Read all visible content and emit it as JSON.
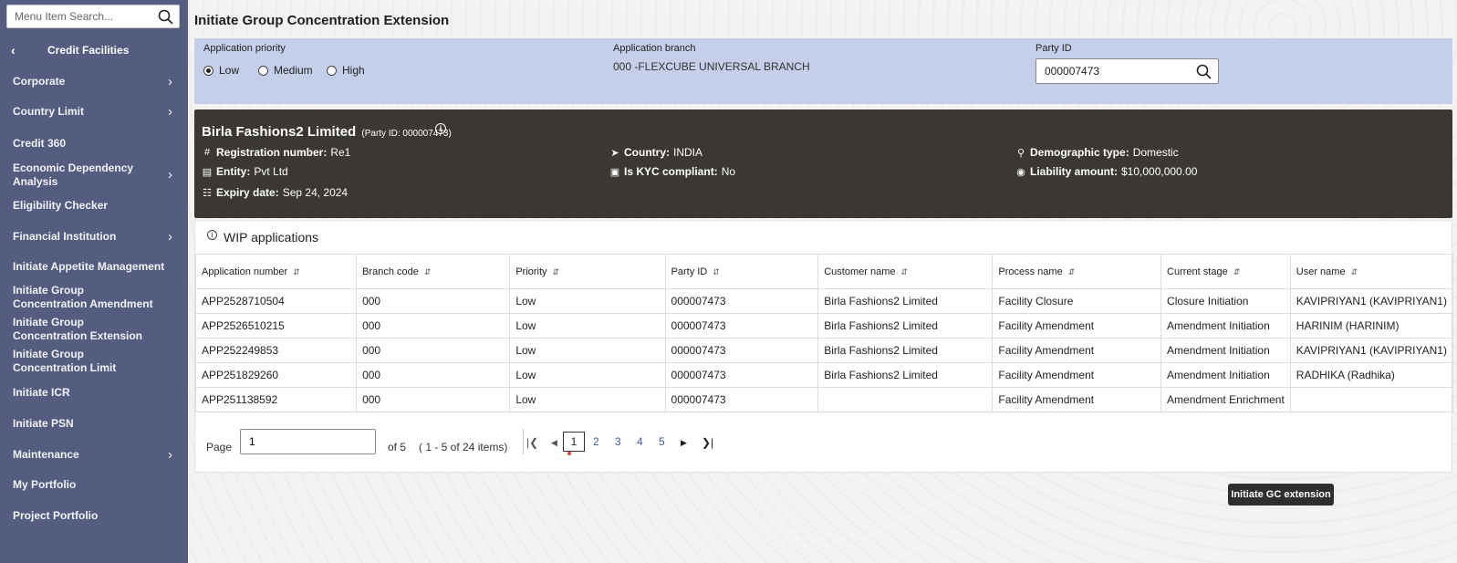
{
  "search": {
    "placeholder": "Menu Item Search..."
  },
  "sidebar": {
    "header": "Credit Facilities",
    "items": [
      {
        "label": "Corporate",
        "has_children": true
      },
      {
        "label": "Country Limit",
        "has_children": true
      },
      {
        "label": "Credit 360",
        "has_children": false
      },
      {
        "label": "Economic Dependency Analysis",
        "has_children": true
      },
      {
        "label": "Eligibility Checker",
        "has_children": false
      },
      {
        "label": "Financial Institution",
        "has_children": true
      },
      {
        "label": "Initiate Appetite Management",
        "has_children": false
      },
      {
        "label": "Initiate Group Concentration Amendment",
        "has_children": false
      },
      {
        "label": "Initiate Group Concentration Extension",
        "has_children": false
      },
      {
        "label": "Initiate Group Concentration Limit",
        "has_children": false
      },
      {
        "label": "Initiate ICR",
        "has_children": false
      },
      {
        "label": "Initiate PSN",
        "has_children": false
      },
      {
        "label": "Maintenance",
        "has_children": true
      },
      {
        "label": "My Portfolio",
        "has_children": false
      },
      {
        "label": "Project Portfolio",
        "has_children": false
      }
    ]
  },
  "page": {
    "title": "Initiate Group Concentration Extension"
  },
  "form": {
    "priority_label": "Application priority",
    "priority_options": [
      "Low",
      "Medium",
      "High"
    ],
    "priority_selected": "Low",
    "branch_label": "Application branch",
    "branch_value": "000 -FLEXCUBE UNIVERSAL BRANCH",
    "party_label": "Party ID",
    "party_value": "000007473"
  },
  "party": {
    "name": "Birla Fashions2 Limited",
    "party_id_text": "(Party ID: 000007473)",
    "registration_label": "Registration number:",
    "registration_value": "Re1",
    "country_label": "Country:",
    "country_value": "INDIA",
    "demographic_label": "Demographic type:",
    "demographic_value": "Domestic",
    "entity_label": "Entity:",
    "entity_value": "Pvt Ltd",
    "kyc_label": "Is KYC compliant:",
    "kyc_value": "No",
    "liability_label": "Liability amount:",
    "liability_value": "$10,000,000.00",
    "expiry_label": "Expiry date:",
    "expiry_value": "Sep 24, 2024"
  },
  "wip": {
    "title": "WIP applications",
    "columns": [
      "Application number",
      "Branch code",
      "Priority",
      "Party ID",
      "Customer name",
      "Process name",
      "Current stage",
      "User name"
    ],
    "rows": [
      [
        "APP2528710504",
        "000",
        "Low",
        "000007473",
        "Birla Fashions2 Limited",
        "Facility Closure",
        "Closure Initiation",
        "KAVIPRIYAN1 (KAVIPRIYAN1)"
      ],
      [
        "APP2526510215",
        "000",
        "Low",
        "000007473",
        "Birla Fashions2 Limited",
        "Facility Amendment",
        "Amendment Initiation",
        "HARINIM (HARINIM)"
      ],
      [
        "APP252249853",
        "000",
        "Low",
        "000007473",
        "Birla Fashions2 Limited",
        "Facility Amendment",
        "Amendment Initiation",
        "KAVIPRIYAN1 (KAVIPRIYAN1)"
      ],
      [
        "APP251829260",
        "000",
        "Low",
        "000007473",
        "Birla Fashions2 Limited",
        "Facility Amendment",
        "Amendment Initiation",
        "RADHIKA (Radhika)"
      ],
      [
        "APP251138592",
        "000",
        "Low",
        "000007473",
        "",
        "Facility Amendment",
        "Amendment Enrichment",
        ""
      ]
    ]
  },
  "pager": {
    "page_label": "Page",
    "page_value": "1",
    "of_text": "of 5",
    "items_text": "( 1 - 5 of 24 items)",
    "pages": [
      "1",
      "2",
      "3",
      "4",
      "5"
    ],
    "current": "1"
  },
  "actions": {
    "primary": "Initiate GC extension"
  }
}
